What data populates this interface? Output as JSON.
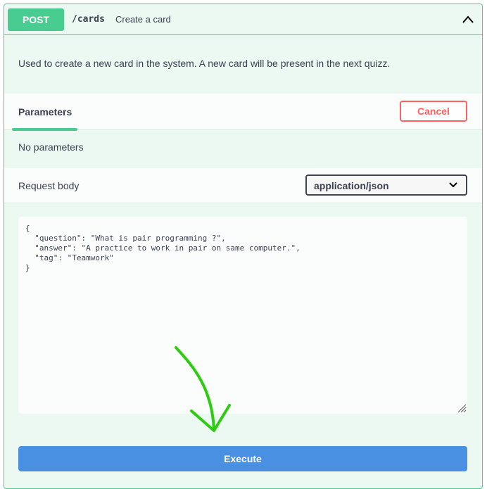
{
  "operation": {
    "method": "POST",
    "path": "/cards",
    "summary": "Create a card",
    "description": "Used to create a new card in the system. A new card will be present in the next quizz."
  },
  "parameters": {
    "tab_label": "Parameters",
    "cancel_label": "Cancel",
    "empty_text": "No parameters"
  },
  "request_body": {
    "label": "Request body",
    "content_type": "application/json",
    "editor_value": "{\n  \"question\": \"What is pair programming ?\",\n  \"answer\": \"A practice to work in pair on same computer.\",\n  \"tag\": \"Teamwork\"\n}"
  },
  "actions": {
    "execute_label": "Execute"
  },
  "colors": {
    "post_green": "#49cc90",
    "panel_bg": "#ecf8f2",
    "cancel_red": "#ff6060",
    "execute_blue": "#4990e2",
    "annotation_arrow": "#2ecc10"
  }
}
